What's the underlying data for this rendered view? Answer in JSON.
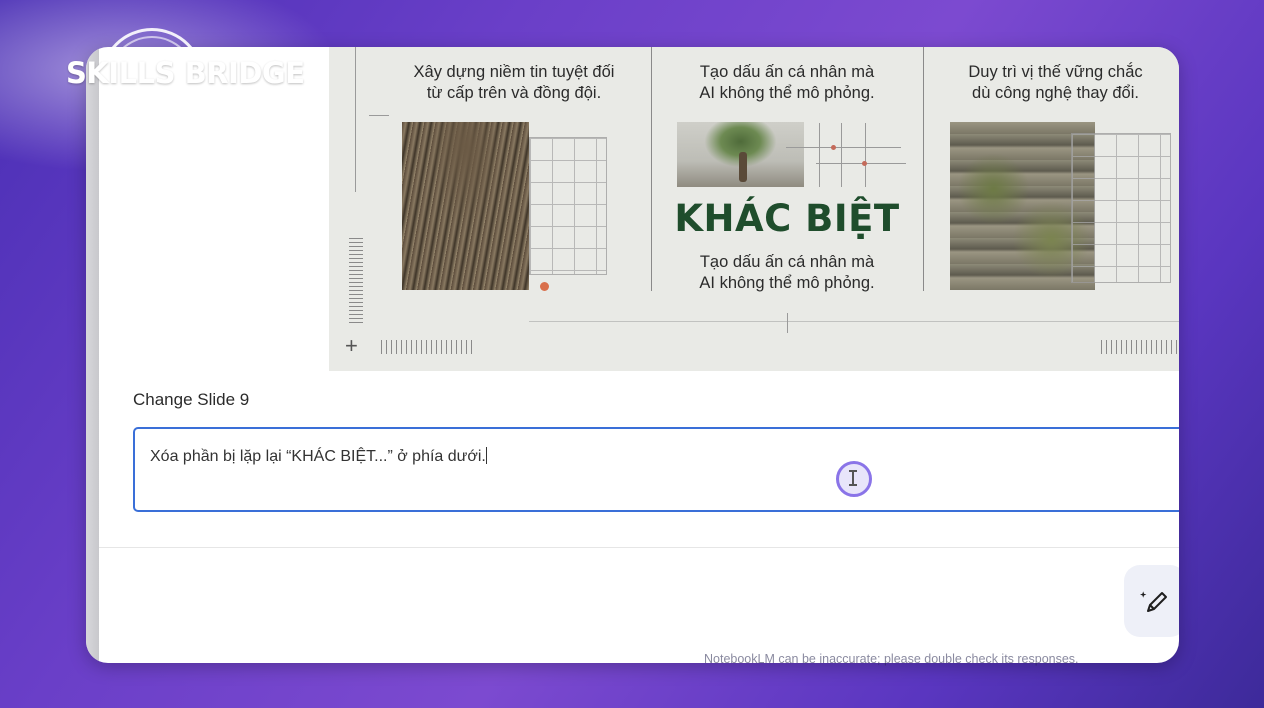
{
  "brand": {
    "logo_text": "SKILLS BRIDGE"
  },
  "slide": {
    "col1_text_line1": "Xây dựng niềm tin tuyệt đối",
    "col1_text_line2": "từ cấp trên và đồng đội.",
    "col2_text_line1": "Tạo dấu ấn cá nhân mà",
    "col2_text_line2": "AI không thể mô phỏng.",
    "col2_title": "KHÁC BIỆT",
    "col2_sub_line1": "Tạo dấu ấn cá nhân mà",
    "col2_sub_line2": "AI không thể mô phỏng.",
    "col3_text_line1": "Duy trì vị thế vững chắc",
    "col3_text_line2": "dù công nghệ thay đổi."
  },
  "change": {
    "label": "Change Slide 9",
    "input_value": "Xóa phần bị lặp lại “KHÁC BIỆT...” ở phía dưới."
  },
  "footer": {
    "disclaimer": "NotebookLM can be inaccurate; please double check its responses."
  },
  "colors": {
    "accent": "#3a6fd8",
    "title_green": "#1f4d2c",
    "cursor": "#8a74e8"
  },
  "icons": {
    "edit": "magic-pen-icon"
  }
}
